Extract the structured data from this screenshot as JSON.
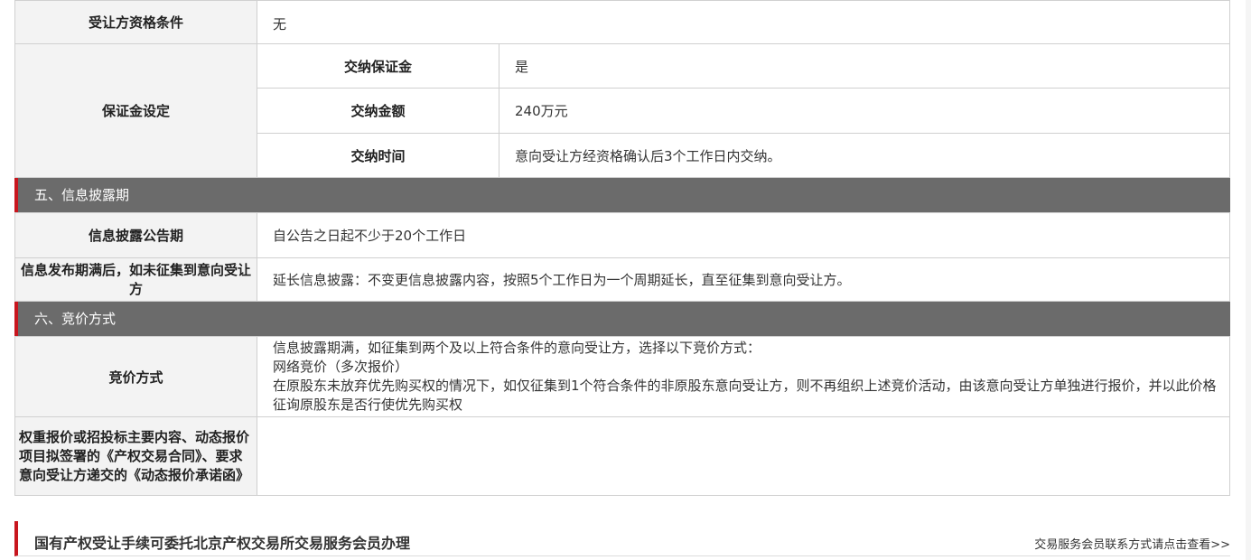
{
  "eligibility": {
    "label": "受让方资格条件",
    "value": "无"
  },
  "deposit": {
    "label": "保证金设定",
    "rows": [
      {
        "label": "交纳保证金",
        "value": "是"
      },
      {
        "label": "交纳金额",
        "value": "240万元"
      },
      {
        "label": "交纳时间",
        "value": "意向受让方经资格确认后3个工作日内交纳。"
      }
    ]
  },
  "section5": {
    "title": "五、信息披露期",
    "period_label": "信息披露公告期",
    "period_value": "自公告之日起不少于20个工作日",
    "expiry_label": "信息发布期满后，如未征集到意向受让方",
    "expiry_value": "延长信息披露：不变更信息披露内容，按照5个工作日为一个周期延长，直至征集到意向受让方。"
  },
  "section6": {
    "title": "六、竞价方式",
    "method_label": "竞价方式",
    "method_lines": [
      "信息披露期满，如征集到两个及以上符合条件的意向受让方，选择以下竞价方式：",
      "网络竞价（多次报价）",
      "在原股东未放弃优先购买权的情况下，如仅征集到1个符合条件的非原股东意向受让方，则不再组织上述竞价活动，由该意向受让方单独进行报价，并以此价格征询原股东是否行使优先购买权"
    ],
    "contract_label": "权重报价或招投标主要内容、动态报价项目拟签署的《产权交易合同》、要求意向受让方递交的《动态报价承诺函》",
    "contract_value": ""
  },
  "footer": {
    "title": "国有产权受让手续可委托北京产权交易所交易服务会员办理",
    "link": "交易服务会员联系方式请点击查看>>"
  },
  "colors": {
    "accent": "#c8161e",
    "section_bg": "#6b6b6b",
    "label_bg": "#f3f3f3"
  }
}
